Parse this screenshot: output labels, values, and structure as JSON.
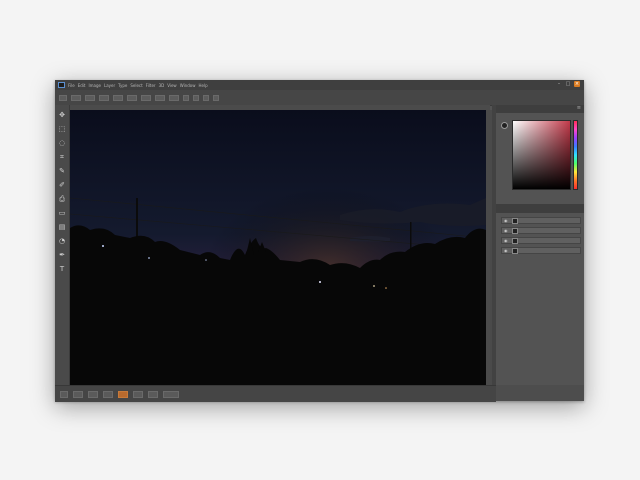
{
  "app": {
    "menu_items": [
      "Ps",
      "File",
      "Edit",
      "Image",
      "Layer",
      "Type",
      "Select",
      "Filter",
      "3D",
      "View",
      "Window",
      "Help"
    ],
    "doc_tab_text": "",
    "window_controls": [
      "minimize",
      "maximize",
      "close"
    ],
    "accent_color": "#d87a20"
  },
  "options_bar": {
    "zoom_readout": ""
  },
  "toolbar": {
    "icons": [
      "move-icon",
      "marquee-icon",
      "lasso-icon",
      "crop-icon",
      "eyedropper-icon",
      "brush-icon",
      "clone-stamp-icon",
      "eraser-icon",
      "gradient-icon",
      "dodge-icon",
      "pen-icon",
      "type-icon"
    ]
  },
  "canvas": {
    "description_colors": {
      "sky_top": "#0a0d1c",
      "sky_horizon": "#2a2140",
      "glow": "#4a2a1a",
      "ground": "#070707"
    }
  },
  "color_panel": {
    "title": "",
    "picker_hue": "#c23a4a"
  },
  "layers_panel": {
    "title": "",
    "layers": [
      {
        "label": ""
      },
      {
        "label": ""
      },
      {
        "label": ""
      },
      {
        "label": ""
      }
    ]
  },
  "bottom_bar": {
    "buttons": [
      "",
      "",
      "",
      "",
      "",
      "",
      "",
      ""
    ]
  }
}
